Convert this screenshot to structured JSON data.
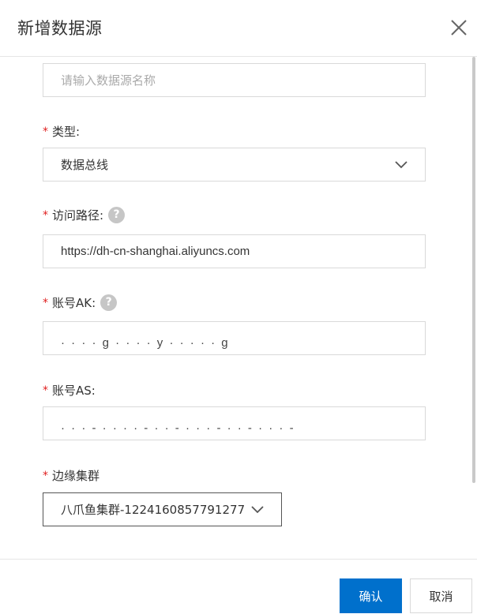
{
  "dialog": {
    "title": "新增数据源"
  },
  "form": {
    "name": {
      "placeholder": "请输入数据源名称",
      "value": ""
    },
    "type": {
      "label": "类型:",
      "required_mark": "*",
      "value": "数据总线"
    },
    "access_path": {
      "label": "访问路径:",
      "required_mark": "*",
      "value": "https://dh-cn-shanghai.aliyuncs.com"
    },
    "account_ak": {
      "label": "账号AK:",
      "required_mark": "*",
      "value": "· · · · g · · · · y · · · · · g"
    },
    "account_as": {
      "label": "账号AS:",
      "required_mark": "*",
      "value": "· · · - · · · · - · · - · · · - · · - · · · -"
    },
    "edge_cluster": {
      "label": "边缘集群",
      "required_mark": "*",
      "value": "八爪鱼集群-1224160857791277"
    }
  },
  "help_icon_glyph": "?",
  "footer": {
    "confirm_label": "确认",
    "cancel_label": "取消"
  },
  "colors": {
    "primary": "#0070cc",
    "required": "#e02020",
    "border": "#d9d9d9",
    "placeholder": "#aaaaaa"
  }
}
